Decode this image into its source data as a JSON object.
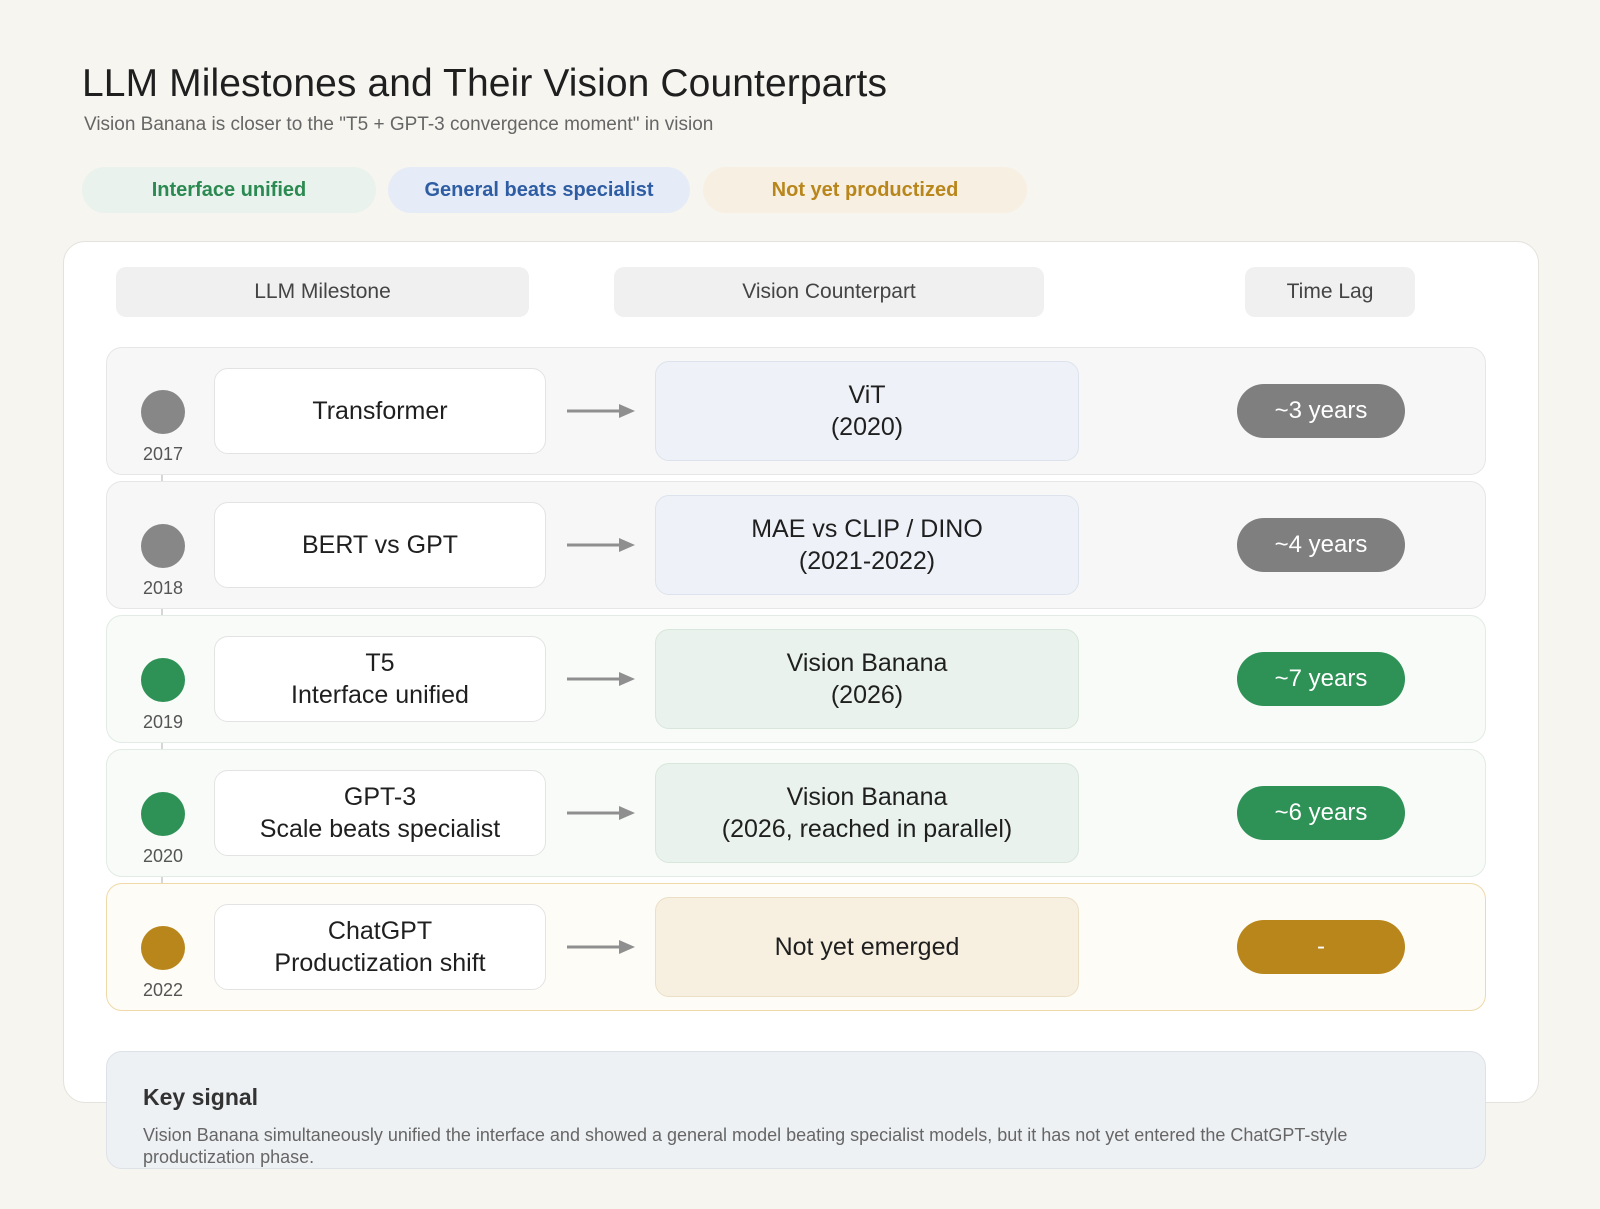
{
  "title": "LLM Milestones and Their Vision Counterparts",
  "subtitle": "Vision Banana is closer to the \"T5 + GPT-3 convergence moment\" in vision",
  "tags": [
    {
      "label": "Interface unified",
      "color": "#2b8a51"
    },
    {
      "label": "General beats specialist",
      "color": "#2e5da3"
    },
    {
      "label": "Not yet productized",
      "color": "#b8861b"
    }
  ],
  "columns": {
    "llm": "LLM Milestone",
    "vision": "Vision Counterpart",
    "lag": "Time Lag"
  },
  "rows": [
    {
      "year": "2017",
      "milestone_line1": "Transformer",
      "milestone_line2": "",
      "vision_line1": "ViT",
      "vision_line2": "(2020)",
      "lag": "~3 years",
      "status": "gray"
    },
    {
      "year": "2018",
      "milestone_line1": "BERT vs GPT",
      "milestone_line2": "",
      "vision_line1": "MAE vs CLIP / DINO",
      "vision_line2": "(2021-2022)",
      "lag": "~4 years",
      "status": "gray"
    },
    {
      "year": "2019",
      "milestone_line1": "T5",
      "milestone_line2": "Interface unified",
      "vision_line1": "Vision Banana",
      "vision_line2": "(2026)",
      "lag": "~7 years",
      "status": "green"
    },
    {
      "year": "2020",
      "milestone_line1": "GPT-3",
      "milestone_line2": "Scale beats specialist",
      "vision_line1": "Vision Banana",
      "vision_line2": "(2026, reached in parallel)",
      "lag": "~6 years",
      "status": "green"
    },
    {
      "year": "2022",
      "milestone_line1": "ChatGPT",
      "milestone_line2": "Productization shift",
      "vision_line1": "Not yet emerged",
      "vision_line2": "",
      "lag": "-",
      "status": "amber"
    }
  ],
  "key_signal": {
    "title": "Key signal",
    "text": "Vision Banana simultaneously unified the interface and showed a general model beating specialist models, but it has not yet entered the ChatGPT-style productization phase."
  },
  "colors": {
    "gray": "#7f7f7f",
    "green": "#2e9156",
    "amber": "#b8861b",
    "blue": "#2e5da3"
  }
}
